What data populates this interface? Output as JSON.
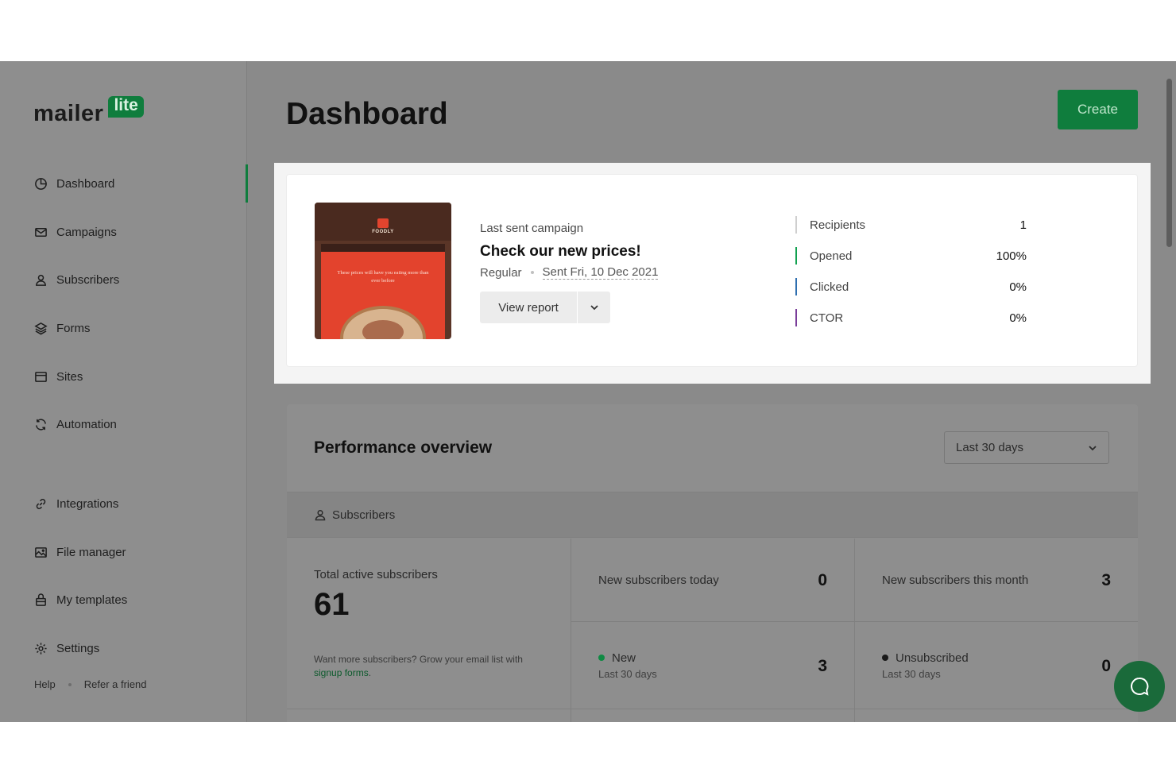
{
  "app": {
    "logo_main": "mailer",
    "logo_badge": "lite"
  },
  "sidebar": {
    "items": [
      {
        "label": "Dashboard",
        "icon": "dashboard-icon",
        "active": true
      },
      {
        "label": "Campaigns",
        "icon": "mail-icon"
      },
      {
        "label": "Subscribers",
        "icon": "user-icon"
      },
      {
        "label": "Forms",
        "icon": "layers-icon"
      },
      {
        "label": "Sites",
        "icon": "browser-icon"
      },
      {
        "label": "Automation",
        "icon": "refresh-icon"
      },
      {
        "label": "Integrations",
        "icon": "link-icon"
      },
      {
        "label": "File manager",
        "icon": "image-icon"
      },
      {
        "label": "My templates",
        "icon": "template-icon"
      },
      {
        "label": "Settings",
        "icon": "gear-icon"
      }
    ],
    "footer": {
      "help": "Help",
      "refer": "Refer a friend"
    }
  },
  "header": {
    "title": "Dashboard",
    "create_label": "Create"
  },
  "campaign": {
    "label": "Last sent campaign",
    "title": "Check our new prices!",
    "type": "Regular",
    "sent": "Sent Fri, 10 Dec 2021",
    "view_report": "View report",
    "thumbnail": {
      "brand": "FOODLY",
      "text": "These prices will have you eating more than ever before"
    },
    "stats": [
      {
        "label": "Recipients",
        "value": "1",
        "color": "#cfcfcf"
      },
      {
        "label": "Opened",
        "value": "100%",
        "color": "#12a150"
      },
      {
        "label": "Clicked",
        "value": "0%",
        "color": "#2f6fb0"
      },
      {
        "label": "CTOR",
        "value": "0%",
        "color": "#7a3d9a"
      }
    ]
  },
  "performance": {
    "title": "Performance overview",
    "range": "Last 30 days",
    "section": "Subscribers",
    "total_label": "Total active subscribers",
    "total_value": "61",
    "hint_prefix": "Want more subscribers? Grow your email list with ",
    "hint_link": "signup forms",
    "hint_suffix": ".",
    "new_today_label": "New subscribers today",
    "new_today_value": "0",
    "new_month_label": "New subscribers this month",
    "new_month_value": "3",
    "new_label": "New",
    "new_sub": "Last 30 days",
    "new_value": "3",
    "new_color": "#0f8a43",
    "unsub_label": "Unsubscribed",
    "unsub_sub": "Last 30 days",
    "unsub_value": "0",
    "unsub_color": "#1a1a1a"
  }
}
